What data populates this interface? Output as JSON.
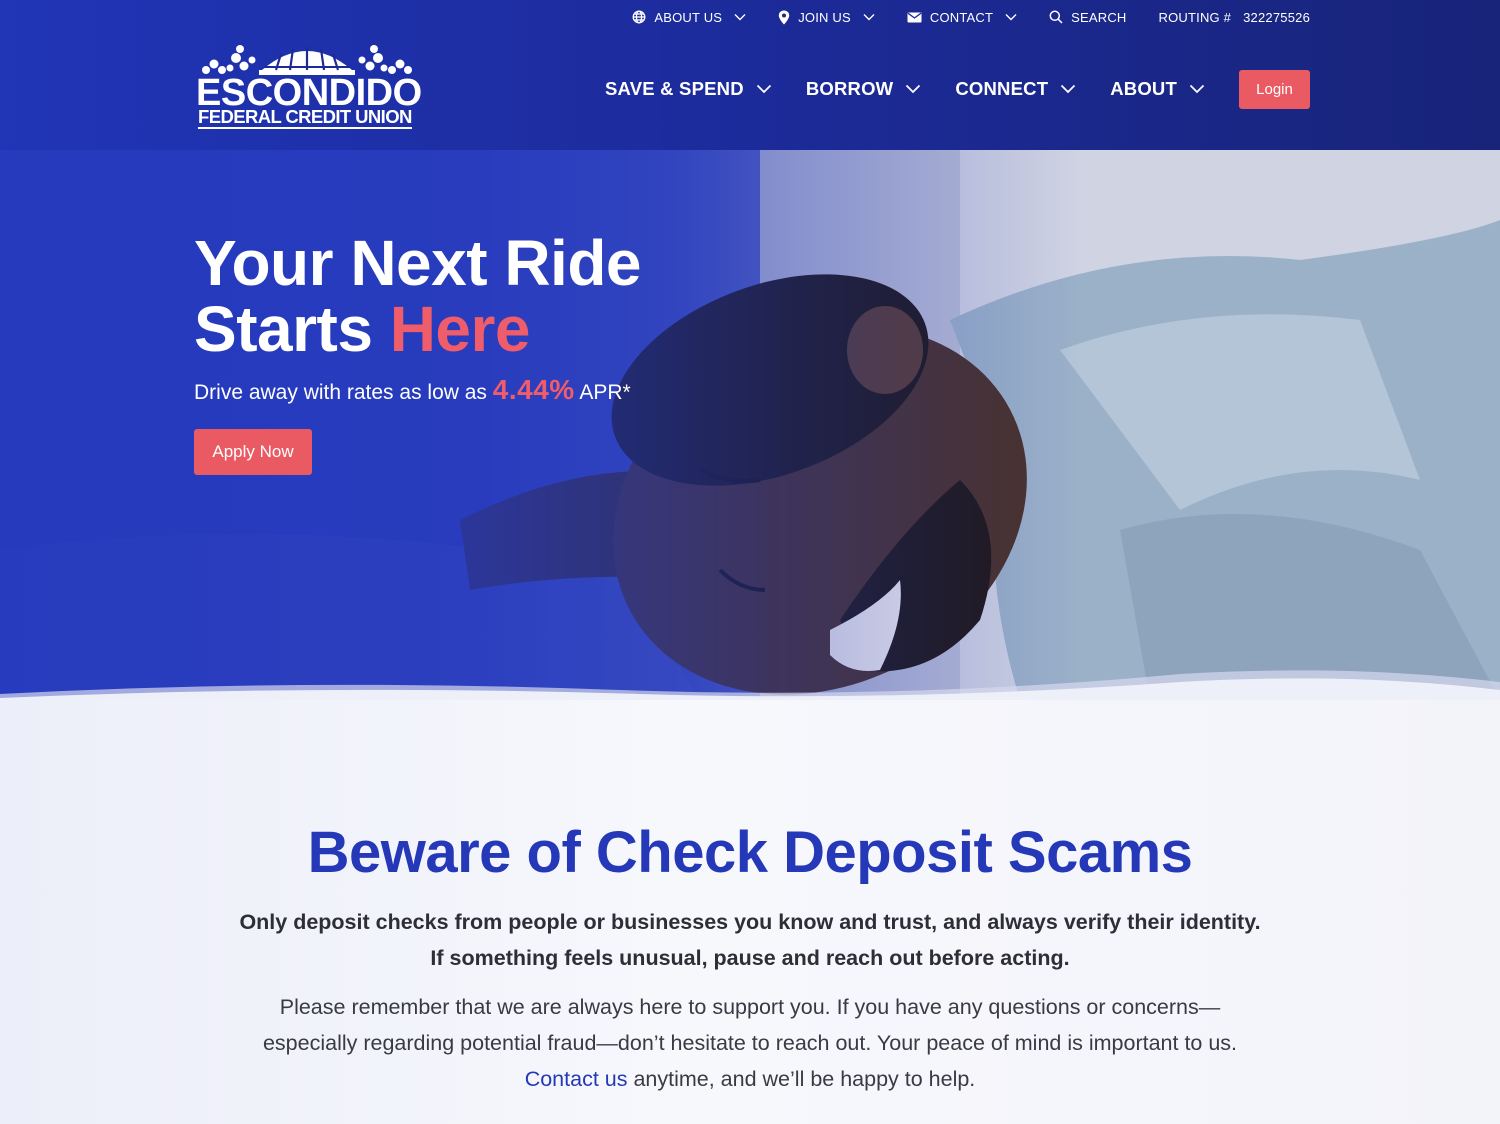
{
  "utility_nav": {
    "about_us": "ABOUT US",
    "join_us": "JOIN US",
    "contact": "CONTACT",
    "search": "SEARCH",
    "routing_label": "ROUTING #",
    "routing_number": "322275526"
  },
  "logo": {
    "line1": "ESCONDIDO",
    "line2": "FEDERAL CREDIT UNION"
  },
  "main_nav": {
    "items": [
      "SAVE & SPEND",
      "BORROW",
      "CONNECT",
      "ABOUT"
    ],
    "login": "Login"
  },
  "hero": {
    "title_line1": "Your Next Ride",
    "title_line2_start": "Starts ",
    "title_line2_accent": "Here",
    "sub_before": "Drive away with rates as low as ",
    "rate": "4.44%",
    "sub_after": " APR*",
    "cta": "Apply Now"
  },
  "notice": {
    "heading": "Beware of Check Deposit Scams",
    "lead_line1": "Only deposit checks from people or businesses you know and trust, and always verify their identity.",
    "lead_line2": "If something feels unusual, pause and reach out before acting.",
    "body_line1": "Please remember that we are always here to support you. If you have any questions or concerns—",
    "body_line2": "especially regarding potential fraud—don’t hesitate to reach out. Your peace of mind is important to us.",
    "contact_link": "Contact us",
    "body_line3_after": " anytime, and we’ll be happy to help."
  },
  "icons": {
    "about_us": "globe-icon",
    "join_us": "location-pin-icon",
    "contact": "envelope-icon",
    "search": "search-icon",
    "dropdown": "chevron-down-icon"
  },
  "colors": {
    "brand_blue": "#2438b8",
    "accent_coral": "#ea5a63",
    "header_dark": "#182479"
  }
}
